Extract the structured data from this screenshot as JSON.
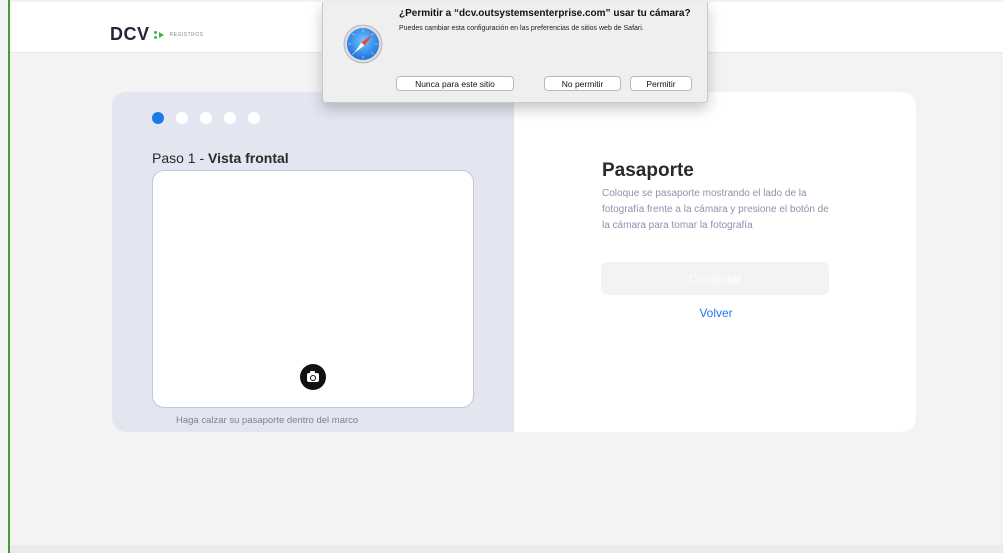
{
  "header": {
    "logo_text": "DCV",
    "logo_sub": "REGISTROS"
  },
  "wizard": {
    "steps_total": 5,
    "current_step": 1,
    "step_prefix": "Paso 1 - ",
    "step_name": "Vista frontal",
    "hint": "Haga calzar su pasaporte dentro del marco"
  },
  "document": {
    "title": "Pasaporte",
    "description": "Coloque se pasaporte mostrando el lado de la fotografía frente a la cámara y presione el botón de la cámara para tomar la fotografía",
    "continue_label": "Continuar",
    "back_label": "Volver"
  },
  "popup": {
    "title": "¿Permitir a “dcv.outsystemsenterprise.com” usar tu cámara?",
    "subtitle": "Puedes cambiar esta configuración en las preferencias de sitios web de Safari.",
    "never_label": "Nunca para este sitio",
    "deny_label": "No permitir",
    "allow_label": "Permitir"
  },
  "icons": {
    "camera": "camera-icon",
    "safari": "safari-compass-icon"
  },
  "colors": {
    "accent": "#1a7ae8",
    "logo_green": "#3db54a",
    "panel_bg": "#e3e6f0"
  }
}
